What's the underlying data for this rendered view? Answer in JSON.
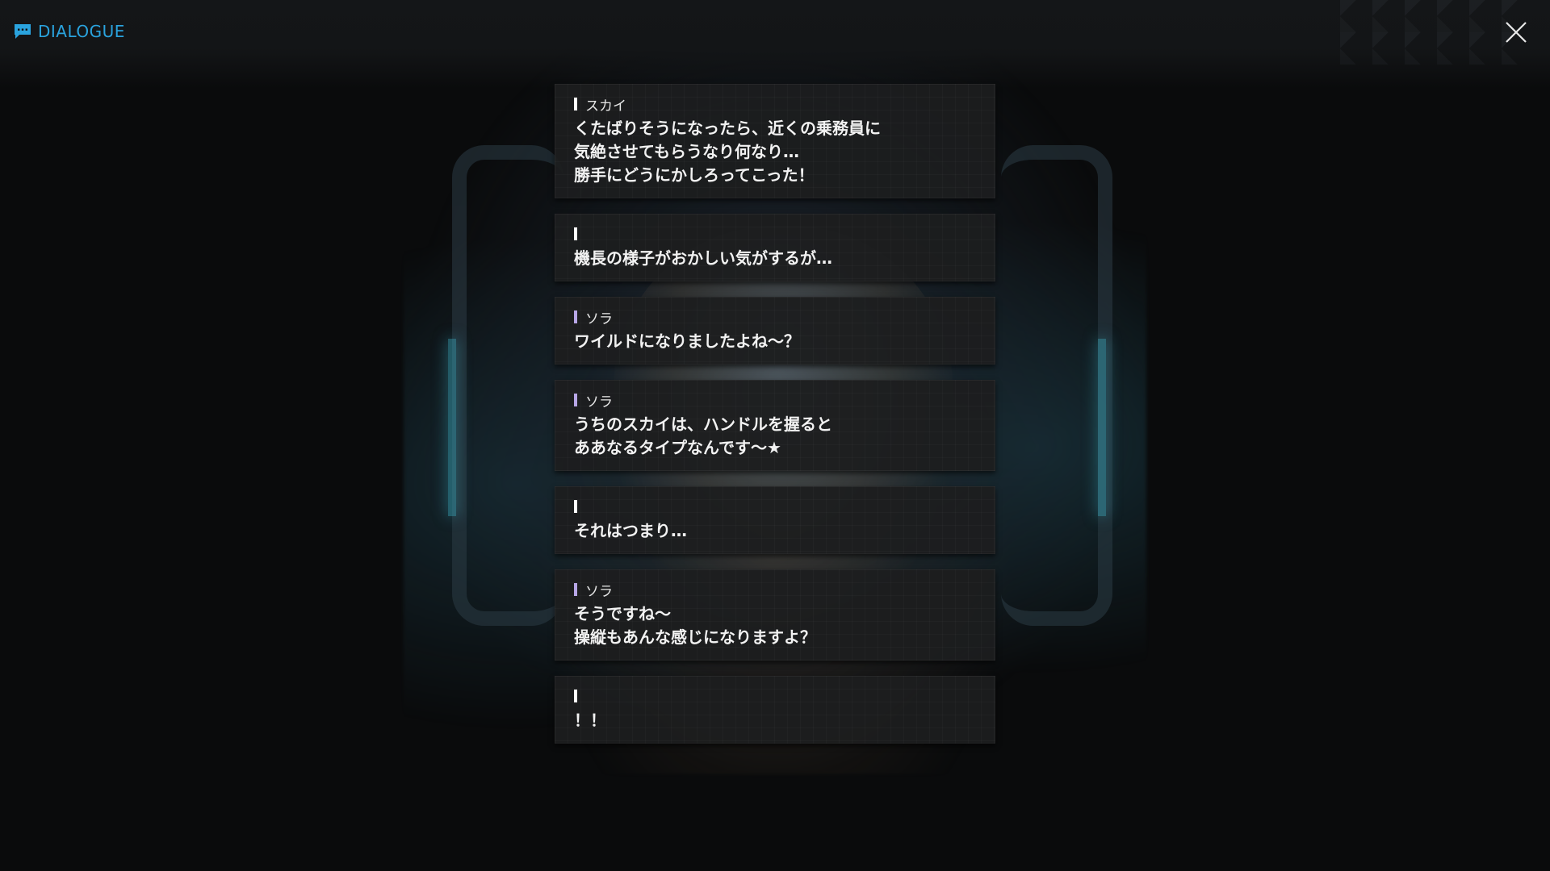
{
  "header": {
    "title": "DIALOGUE",
    "icon": "chat-bubble-icon",
    "accent_color": "#2aa3de"
  },
  "close_button": {
    "icon": "close-x-icon"
  },
  "dialogue": [
    {
      "speaker": "スカイ",
      "bar_color": "#ffffff",
      "text": "くたばりそうになったら、近くの乗務員に\n気絶させてもらうなり何なり…\n勝手にどうにかしろってこった！"
    },
    {
      "speaker": "",
      "bar_color": "#ffffff",
      "text": "機長の様子がおかしい気がするが…"
    },
    {
      "speaker": "ソラ",
      "bar_color": "#b7a6e6",
      "text": "ワイルドになりましたよね～？"
    },
    {
      "speaker": "ソラ",
      "bar_color": "#b7a6e6",
      "text": "うちのスカイは、ハンドルを握ると\nああなるタイプなんです～★"
    },
    {
      "speaker": "",
      "bar_color": "#ffffff",
      "text": "それはつまり…"
    },
    {
      "speaker": "ソラ",
      "bar_color": "#b7a6e6",
      "text": "そうですね～\n操縦もあんな感じになりますよ？"
    },
    {
      "speaker": "",
      "bar_color": "#ffffff",
      "text": "！！"
    }
  ]
}
